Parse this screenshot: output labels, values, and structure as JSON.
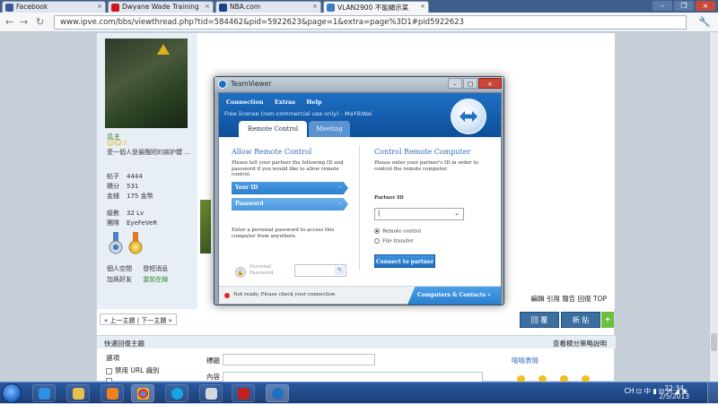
{
  "browser": {
    "tabs": [
      {
        "label": "Facebook",
        "color": "#3b5998"
      },
      {
        "label": "Dwyane Wade Training",
        "color": "#cc181e"
      },
      {
        "label": "NBA.com",
        "color": "#1d428a"
      },
      {
        "label": "VLAN2900 不能顯示某",
        "color": "#3b7dc0"
      }
    ],
    "url": "www.ipve.com/bbs/viewthread.php?tid=584462&pid=5922623&page=1&extra=page%3D1#pid5922623",
    "back": "←",
    "forward": "→",
    "reload": "↻"
  },
  "forum": {
    "username": "瓜主",
    "stars": "☺☺☆",
    "signature": "愛一個人是最醜陋的嫉妒體 ...",
    "stats": [
      {
        "label": "帖子",
        "value": "4444"
      },
      {
        "label": "積分",
        "value": "531"
      },
      {
        "label": "金錢",
        "value": "175 金幣"
      }
    ],
    "level": [
      {
        "label": "級數",
        "value": "32 Lv"
      },
      {
        "label": "團隊",
        "value": "EyeFeVeR"
      }
    ],
    "user_links": [
      "個人空間",
      "發短消息",
      "加爲好友",
      "當前在線"
    ],
    "post_actions": "編輯 引用 報告 回復 TOP",
    "pager": "« 上一主題 | 下一主題 »",
    "reply_button": "回 覆",
    "new_post_button": "新 貼",
    "quick_reply_title": "快速回復主題",
    "quick_reply_right": "查看積分策略說明",
    "options_label": "選項",
    "disable_url": "禁用 URL 識別",
    "subject_label": "標題",
    "content_label": "內容",
    "smilies_label": "嘻嘻表情"
  },
  "teamviewer": {
    "title": "TeamViewer",
    "menu": [
      "Connection",
      "Extras",
      "Help"
    ],
    "license": "Free license (non-commercial use only) - MaYikWai",
    "tabs": [
      "Remote Control",
      "Meeting"
    ],
    "allow_title": "Allow Remote Control",
    "allow_desc": "Please tell your partner the following ID and password if you would like to allow remote control.",
    "your_id_label": "Your ID",
    "password_label": "Password",
    "personal_desc": "Enter a personal password to access this computer from anywhere.",
    "personal_password_label": "Personal Password",
    "control_title": "Control Remote Computer",
    "control_desc": "Please enter your partner's ID in order to control the remote computer.",
    "partner_id_label": "Partner ID",
    "partner_id_value": "|",
    "radio_remote": "Remote control",
    "radio_file": "File transfer",
    "connect_button": "Connect to partner",
    "status": "Not ready. Please check your connection",
    "computers_contacts": "Computers & Contacts »"
  },
  "taskbar": {
    "tray": "CH ⊡ 中 ▮ ⊟ ✉ ◢ ◉",
    "time": "22:34",
    "date": "2/5/2013"
  }
}
